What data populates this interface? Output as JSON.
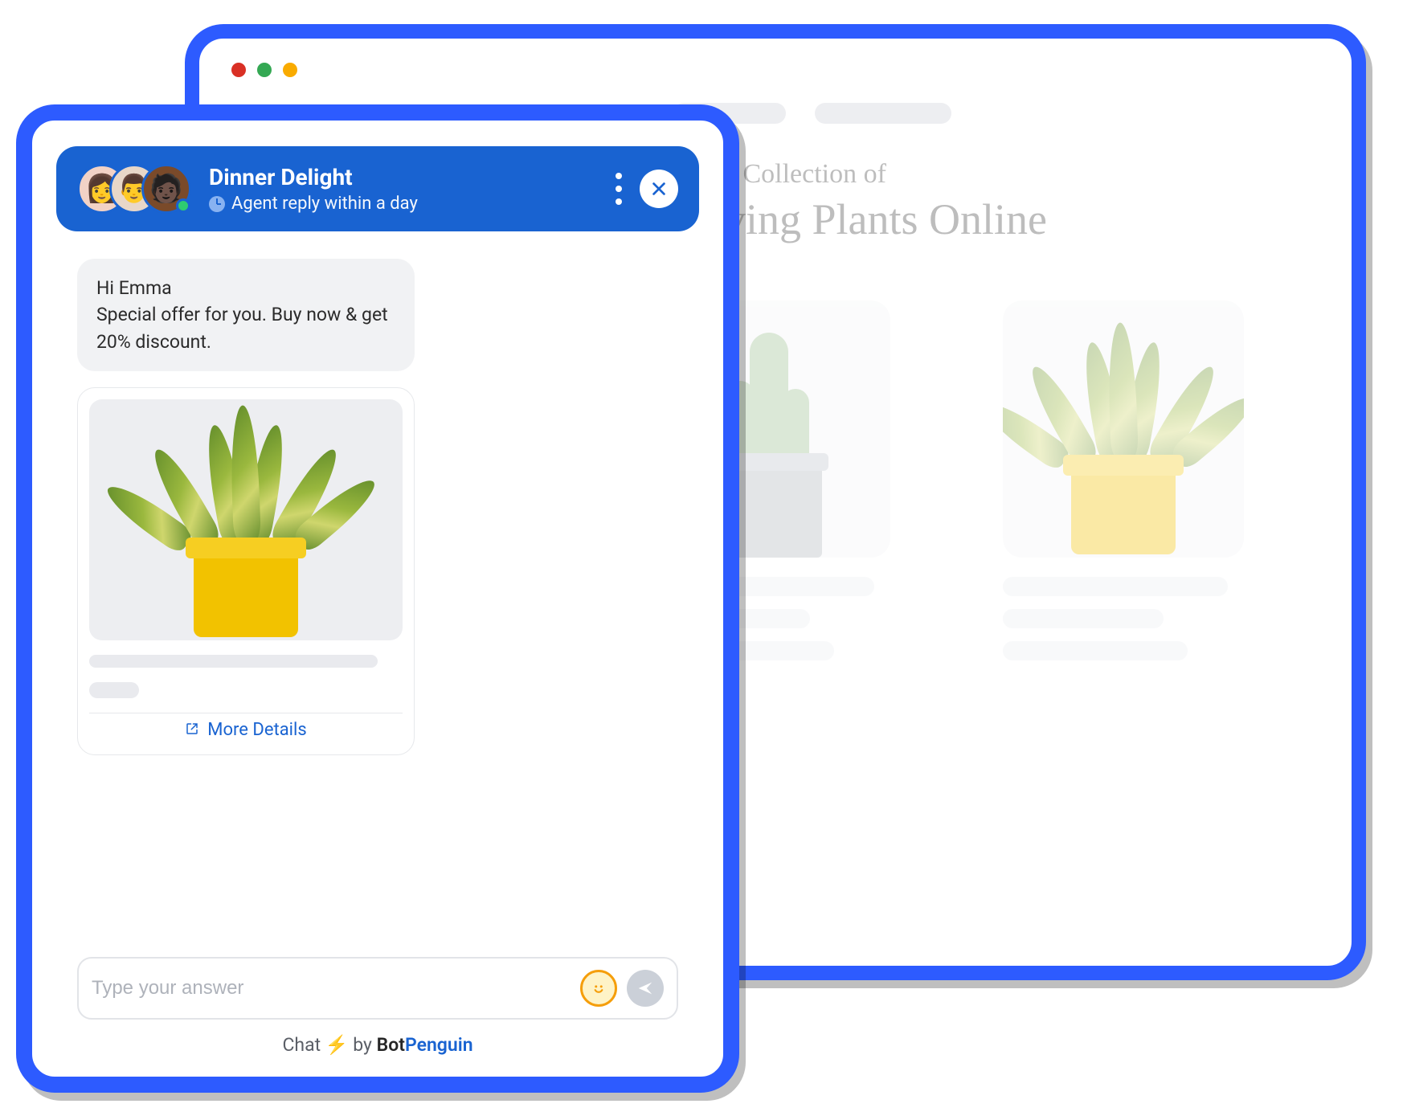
{
  "browser": {
    "hero_line1": "the Vast Collection of",
    "hero_line2": "Thriving Plants Online"
  },
  "chat": {
    "title": "Dinner Delight",
    "subtitle": "Agent reply within a day"
  },
  "message": {
    "line1": "Hi Emma",
    "line2": "Special offer for you. Buy now & get 20% discount."
  },
  "product": {
    "more_details": "More Details"
  },
  "input": {
    "placeholder": "Type your answer"
  },
  "credit": {
    "chat": "Chat",
    "bolt": "⚡",
    "by": "by",
    "bot": "Bot",
    "penguin": "Penguin"
  }
}
